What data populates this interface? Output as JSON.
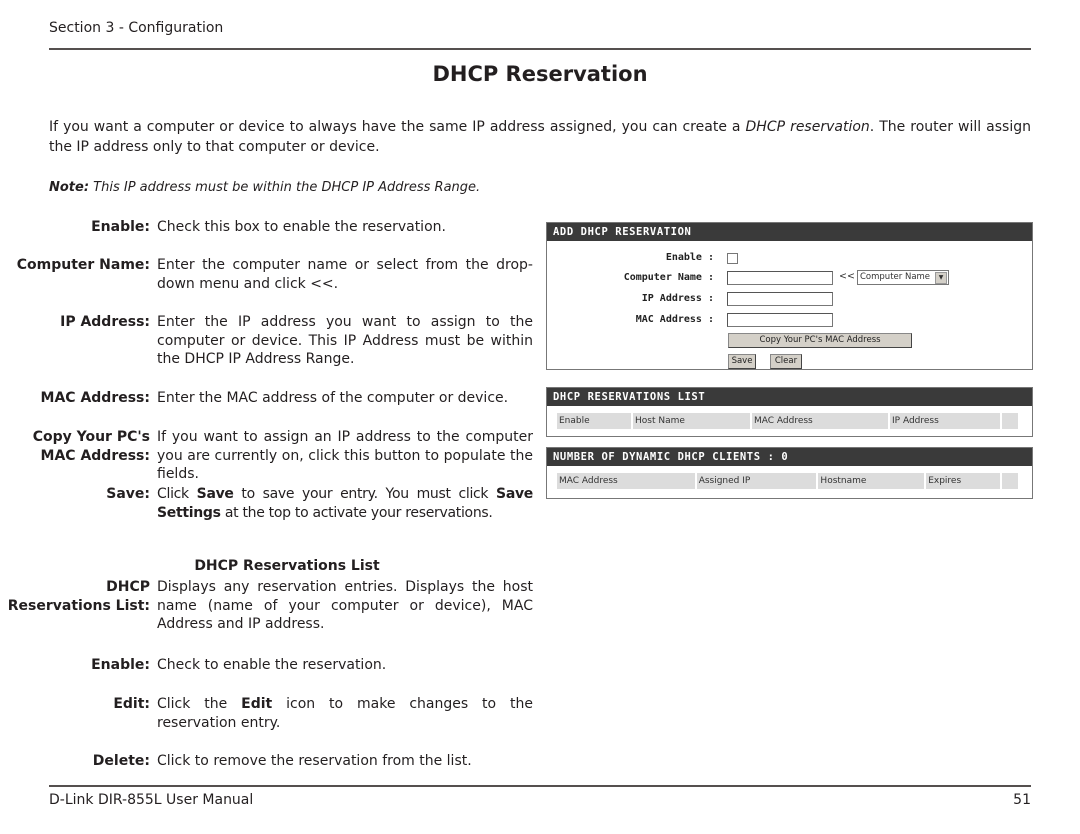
{
  "header": {
    "section": "Section 3 - Configuration"
  },
  "title": "DHCP Reservation",
  "intro": {
    "before": "If you want a computer or device to always have the same IP address assigned, you can create a ",
    "em": "DHCP reservation",
    "after": ". The router will assign the IP address only to that computer or device."
  },
  "note": {
    "label": "Note:",
    "text": " This IP address must be within the DHCP IP Address Range."
  },
  "definitions": [
    {
      "term": "Enable:",
      "desc": "Check this box to enable the reservation."
    },
    {
      "term": "Computer Name:",
      "desc": "Enter the computer name or select from the drop-down menu and click <<."
    },
    {
      "term": "IP Address:",
      "desc": "Enter the IP address you want to assign to the computer or device. This IP Address must be within the DHCP IP Address Range."
    },
    {
      "term": "MAC Address:",
      "desc": "Enter the MAC address of the computer or device."
    },
    {
      "term_line1": "Copy Your PC's",
      "term_line2": "MAC Address:",
      "desc": "If you want to assign an IP address to the computer you are currently on, click this button to populate the fields."
    },
    {
      "term": "Save:",
      "desc_a": "Click ",
      "desc_b": "Save",
      "desc_c": " to save your entry. You must click ",
      "desc_d": "Save Settings",
      "desc_e": " at the top to activate your reservations."
    }
  ],
  "list_section": {
    "heading": "DHCP Reservations List",
    "definitions": [
      {
        "term_line1": "DHCP",
        "term_line2": "Reservations List:",
        "desc": "Displays any reservation entries. Displays the host name (name of your computer or device), MAC Address and IP address."
      },
      {
        "term": "Enable:",
        "desc": "Check to enable the reservation."
      },
      {
        "term": "Edit:",
        "desc_a": "Click the ",
        "desc_b": "Edit",
        "desc_c": " icon to make changes to the reservation entry."
      },
      {
        "term": "Delete:",
        "desc": "Click to remove the reservation from the list."
      }
    ]
  },
  "router_ui": {
    "add_panel": {
      "title": "ADD DHCP RESERVATION",
      "enable_label": "Enable :",
      "computer_name_label": "Computer Name :",
      "ip_label": "IP Address :",
      "mac_label": "MAC Address :",
      "arrows": "<<",
      "select_value": "Computer Name",
      "copy_button": "Copy Your PC's MAC Address",
      "save_button": "Save",
      "clear_button": "Clear"
    },
    "list_panel": {
      "title": "DHCP RESERVATIONS LIST",
      "columns": [
        "Enable",
        "Host Name",
        "MAC Address",
        "IP Address"
      ]
    },
    "clients_panel": {
      "title": "NUMBER OF DYNAMIC DHCP CLIENTS : 0",
      "columns": [
        "MAC Address",
        "Assigned IP",
        "Hostname",
        "Expires"
      ]
    }
  },
  "footer": {
    "manual": "D-Link DIR-855L User Manual",
    "page": "51"
  }
}
